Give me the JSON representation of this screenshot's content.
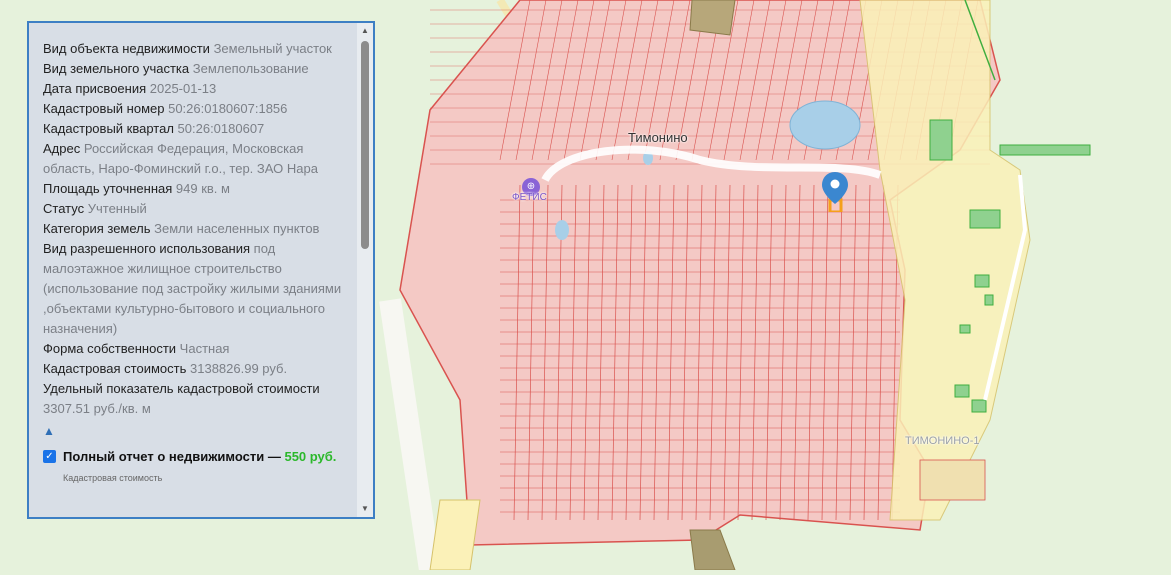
{
  "map": {
    "labels": {
      "timonino": "Тимонино",
      "fetis": "ФЕТИС",
      "snt": "ТИМОНИНО-1"
    },
    "colors": {
      "background": "#e6f2dc",
      "parcel_fill": "#f4c9c5",
      "parcel_line": "#d9534f",
      "yellow_parcels": "#fbf1b8",
      "water": "#a8cfe8",
      "forest_parcels": "#8fd18f",
      "marker": "#3b87d0",
      "selected_parcel": "#f5a01a"
    }
  },
  "panel": {
    "rows": [
      {
        "label": "Вид объекта недвижимости",
        "value": "Земельный участок"
      },
      {
        "label": "Вид земельного участка",
        "value": "Землепользование"
      },
      {
        "label": "Дата присвоения",
        "value": "2025-01-13"
      },
      {
        "label": "Кадастровый номер",
        "value": "50:26:0180607:1856"
      },
      {
        "label": "Кадастровый квартал",
        "value": "50:26:0180607"
      },
      {
        "label": "Адрес",
        "value": "Российская Федерация, Московская область, Наро-Фоминский г.о., тер. ЗАО Нара"
      },
      {
        "label": "Площадь уточненная",
        "value": "949 кв. м"
      },
      {
        "label": "Статус",
        "value": "Учтенный"
      },
      {
        "label": "Категория земель",
        "value": "Земли населенных пунктов"
      },
      {
        "label": "Вид разрешенного использования",
        "value": "под малоэтажное жилищное строительство (использование под застройку жилыми зданиями ,объектами культурно-бытового и социального назначения)"
      },
      {
        "label": "Форма собственности",
        "value": "Частная"
      },
      {
        "label": "Кадастровая стоимость",
        "value": "3138826.99 руб."
      },
      {
        "label": "Удельный показатель кадастровой стоимости",
        "value": "3307.51 руб./кв. м"
      }
    ],
    "collapse_icon": "▲",
    "report": {
      "text": "Полный отчет о недвижимости —",
      "price": "550 руб.",
      "checked": true
    },
    "extra_text": "Кадастровая стоимость"
  }
}
